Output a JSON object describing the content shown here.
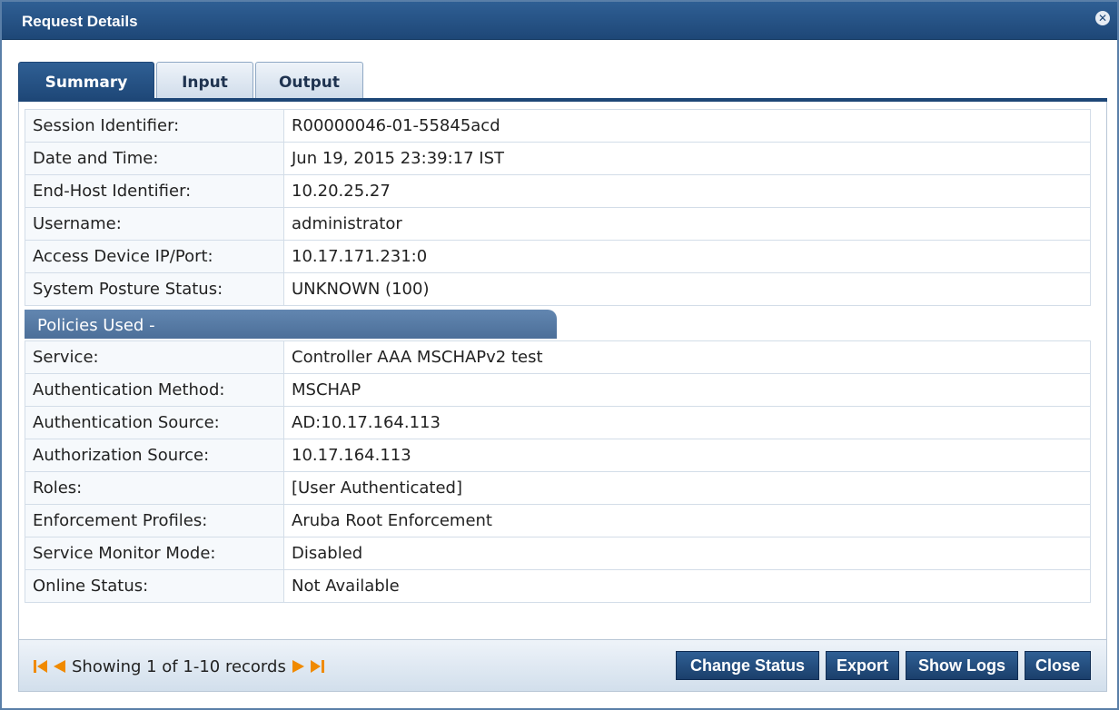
{
  "window": {
    "title": "Request Details"
  },
  "tabs": [
    {
      "label": "Summary",
      "active": true
    },
    {
      "label": "Input",
      "active": false
    },
    {
      "label": "Output",
      "active": false
    }
  ],
  "session": {
    "rows": [
      {
        "key": "Session Identifier:",
        "value": "R00000046-01-55845acd"
      },
      {
        "key": "Date and Time:",
        "value": "Jun 19, 2015 23:39:17 IST"
      },
      {
        "key": "End-Host Identifier:",
        "value": "10.20.25.27"
      },
      {
        "key": "Username:",
        "value": "administrator"
      },
      {
        "key": "Access Device IP/Port:",
        "value": "10.17.171.231:0"
      },
      {
        "key": "System Posture Status:",
        "value": "UNKNOWN (100)"
      }
    ]
  },
  "policies": {
    "header": "Policies Used -",
    "rows": [
      {
        "key": "Service:",
        "value": "Controller AAA MSCHAPv2 test"
      },
      {
        "key": "Authentication Method:",
        "value": "MSCHAP"
      },
      {
        "key": "Authentication Source:",
        "value": "AD:10.17.164.113"
      },
      {
        "key": "Authorization Source:",
        "value": "10.17.164.113"
      },
      {
        "key": "Roles:",
        "value": "[User Authenticated]"
      },
      {
        "key": "Enforcement Profiles:",
        "value": "Aruba Root Enforcement"
      },
      {
        "key": "Service Monitor Mode:",
        "value": "Disabled"
      },
      {
        "key": "Online Status:",
        "value": "Not Available"
      }
    ]
  },
  "footer": {
    "pager_text": "Showing 1 of 1-10 records",
    "buttons": {
      "change_status": "Change Status",
      "export": "Export",
      "show_logs": "Show Logs",
      "close": "Close"
    }
  },
  "icons": {
    "close": "close-circle-icon",
    "first": "first-page-icon",
    "prev": "prev-page-icon",
    "next": "next-page-icon",
    "last": "last-page-icon"
  },
  "colors": {
    "accent": "#1e4777",
    "pager_arrow": "#f08a00"
  }
}
